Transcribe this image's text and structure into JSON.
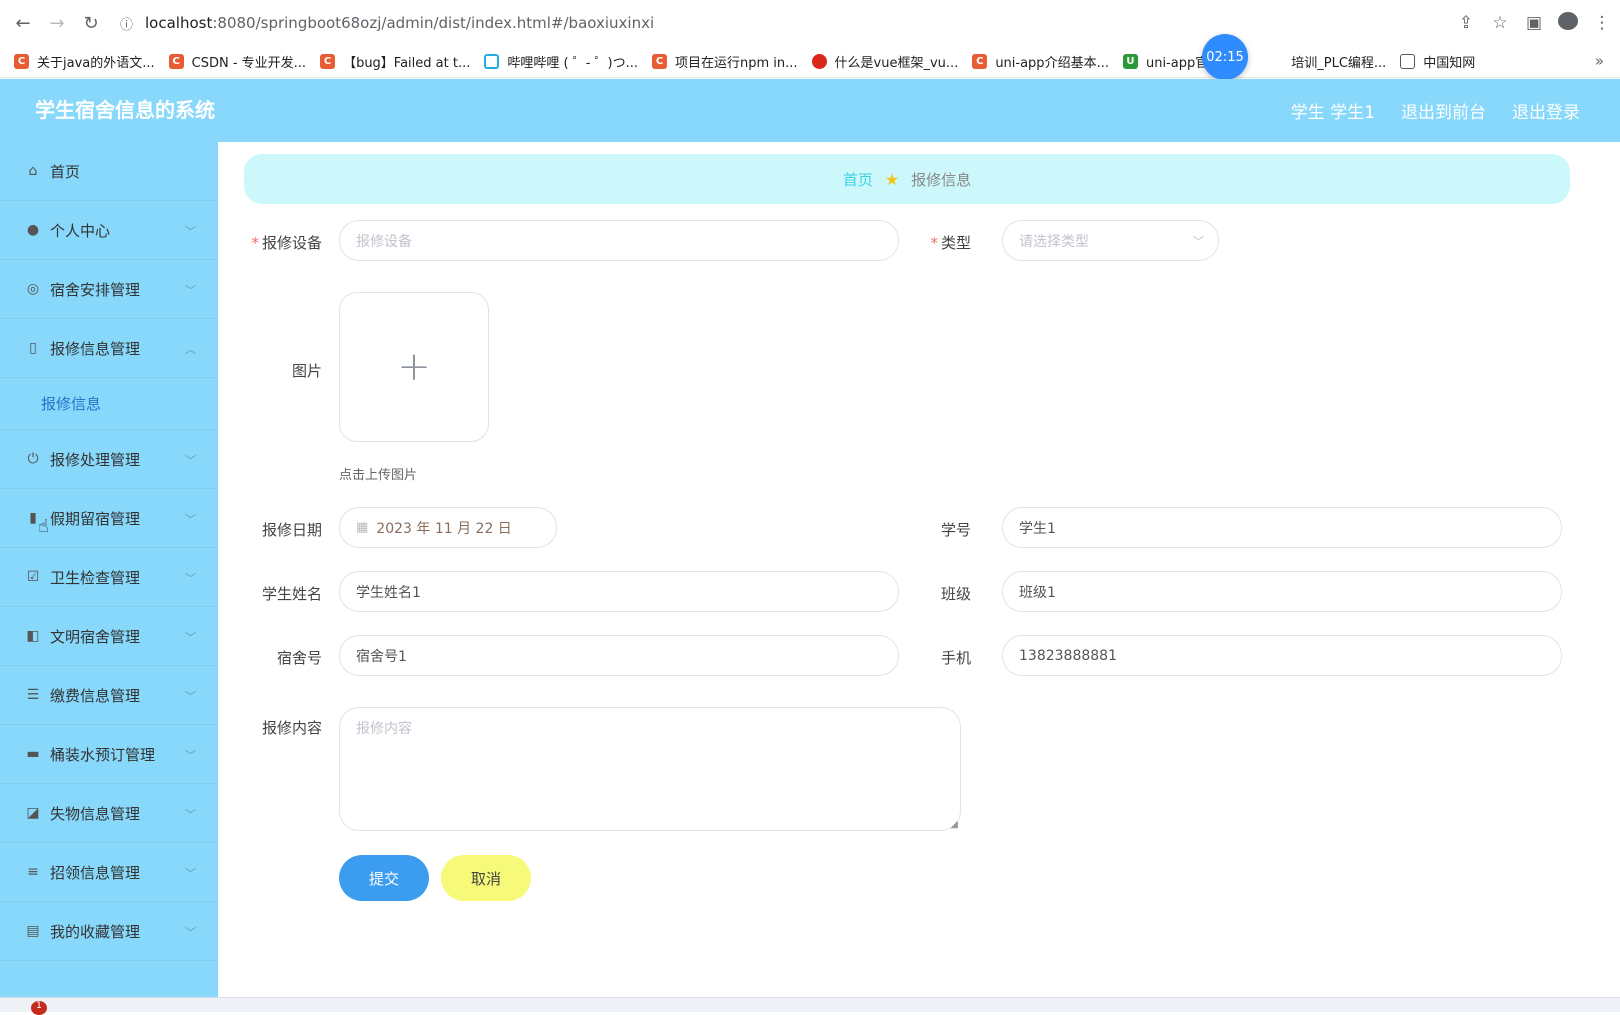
{
  "browser": {
    "url_host": "localhost",
    "url_path": ":8080/springboot68ozj/admin/dist/index.html#/baoxiuxinxi",
    "bookmarks": [
      {
        "label": "关于java的外语文..."
      },
      {
        "label": "CSDN - 专业开发..."
      },
      {
        "label": "【bug】Failed at t..."
      },
      {
        "label": "哔哩哔哩 ( ゜- ゜)つ..."
      },
      {
        "label": "项目在运行npm in..."
      },
      {
        "label": "什么是vue框架_vu..."
      },
      {
        "label": "uni-app介绍基本..."
      },
      {
        "label": "uni-app官网"
      },
      {
        "label": "培训_PLC编程..."
      },
      {
        "label": "中国知网"
      }
    ],
    "more": "»",
    "timer": "02:15"
  },
  "header": {
    "title": "学生宿舍信息的系统",
    "user": "学生 学生1",
    "to_front": "退出到前台",
    "logout": "退出登录"
  },
  "sidebar": {
    "items": [
      {
        "label": "首页"
      },
      {
        "label": "个人中心"
      },
      {
        "label": "宿舍安排管理"
      },
      {
        "label": "报修信息管理"
      },
      {
        "label": "报修信息"
      },
      {
        "label": "报修处理管理"
      },
      {
        "label": "假期留宿管理"
      },
      {
        "label": "卫生检查管理"
      },
      {
        "label": "文明宿舍管理"
      },
      {
        "label": "缴费信息管理"
      },
      {
        "label": "桶装水预订管理"
      },
      {
        "label": "失物信息管理"
      },
      {
        "label": "招领信息管理"
      },
      {
        "label": "我的收藏管理"
      }
    ]
  },
  "breadcrumb": {
    "home": "首页",
    "current": "报修信息"
  },
  "form": {
    "device_label": "报修设备",
    "device_placeholder": "报修设备",
    "type_label": "类型",
    "type_placeholder": "请选择类型",
    "image_label": "图片",
    "upload_tip": "点击上传图片",
    "date_label": "报修日期",
    "date_value": "2023 年 11 月 22 日",
    "student_no_label": "学号",
    "student_no_value": "学生1",
    "name_label": "学生姓名",
    "name_value": "学生姓名1",
    "class_label": "班级",
    "class_value": "班级1",
    "dorm_label": "宿舍号",
    "dorm_value": "宿舍号1",
    "phone_label": "手机",
    "phone_value": "13823888881",
    "content_label": "报修内容",
    "content_placeholder": "报修内容",
    "required_mark": "*",
    "submit": "提交",
    "cancel": "取消"
  },
  "taskbar": {
    "badge": "1"
  }
}
